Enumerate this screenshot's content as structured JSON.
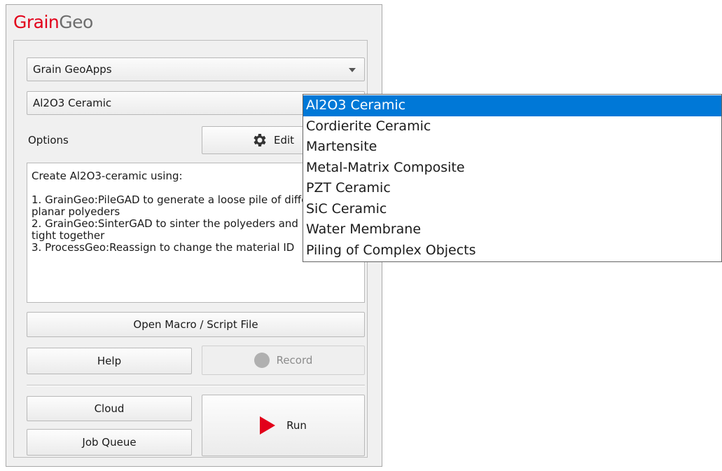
{
  "app": {
    "logo_part1": "Grain",
    "logo_part2": "Geo"
  },
  "apps_combo": {
    "value": "Grain GeoApps"
  },
  "material_combo": {
    "value": "Al2O3 Ceramic",
    "options": [
      "Al2O3 Ceramic",
      "Cordierite Ceramic",
      "Martensite",
      "Metal-Matrix Composite",
      "PZT Ceramic",
      "SiC Ceramic",
      "Water Membrane",
      "Piling of Complex Objects"
    ],
    "selected_index": 0
  },
  "options": {
    "label": "Options",
    "edit_label": "Edit"
  },
  "description": "Create Al2O3-ceramic using:\n\n1. GrainGeo:PileGAD to generate a loose pile of different planar polyeders\n2. GrainGeo:SinterGAD to sinter the polyeders and pack them tight together\n3. ProcessGeo:Reassign to change the material ID",
  "buttons": {
    "open_macro": "Open Macro / Script File",
    "help": "Help",
    "record": "Record",
    "cloud": "Cloud",
    "job_queue": "Job Queue",
    "run": "Run"
  },
  "colors": {
    "brand_red": "#e2001a",
    "selection_blue": "#0078d7"
  },
  "icons": [
    "gear-icon",
    "record-icon",
    "play-icon",
    "chevron-down-icon"
  ]
}
